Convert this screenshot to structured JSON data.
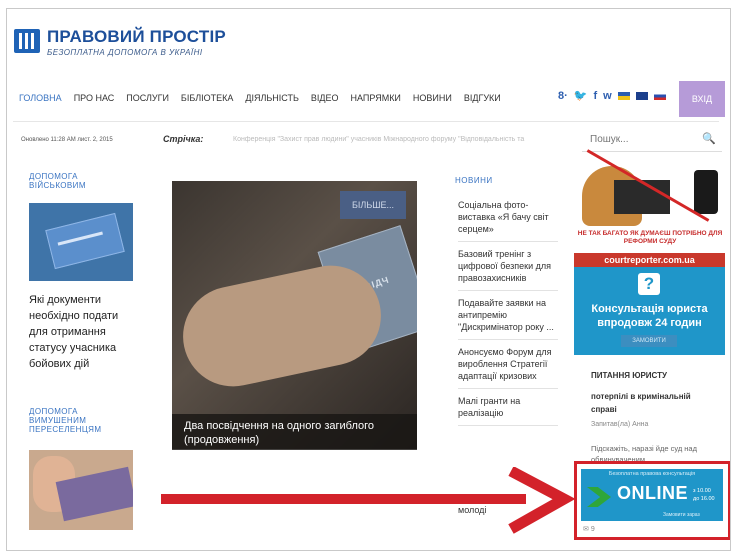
{
  "brand": {
    "name": "ПРАВОВИЙ ПРОСТІР",
    "tagline": "БЕЗОПЛАТНА ДОПОМОГА В УКРАЇНІ"
  },
  "nav": {
    "items": [
      "ГОЛОВНА",
      "ПРО НАС",
      "ПОСЛУГИ",
      "БІБЛІОТЕКА",
      "ДІЯЛЬНІСТЬ",
      "ВІДЕО",
      "НАПРЯМКИ",
      "НОВИНИ",
      "ВІДГУКИ"
    ],
    "active_index": 0
  },
  "social": {
    "icons": [
      "g+",
      "twitter-icon",
      "facebook-icon",
      "vk-icon"
    ],
    "labels": [
      "8·",
      "🐦",
      "f",
      "w"
    ]
  },
  "login": {
    "label": "ВХІД"
  },
  "ticker": {
    "updated": "Оновлено 11:28 AM лист. 2, 2015",
    "label": "Стрічка:",
    "text": "Конференція \"Захист прав людини\" учасників Міжнародного форуму \"Відповідальність та"
  },
  "search": {
    "placeholder": "Пошук..."
  },
  "left": {
    "section1": "ДОПОМОГА ВІЙСЬКОВИМ",
    "article1": "Які документи необхідно подати для отримання статусу учасника бойових дій",
    "section2": "ДОПОМОГА ВИМУШЕНИМ ПЕРЕСЕЛЕНЦЯМ"
  },
  "feature": {
    "more": "БІЛЬШЕ...",
    "card_text": "ПОСВІДЧ",
    "caption": "Два посвідчення на одного загиблого (продовження)"
  },
  "news": {
    "heading": "НОВИНИ",
    "items": [
      "Соціальна фото-виставка «Я бачу світ серцем»",
      "Базовий тренінг з цифрової безпеки для правозахисників",
      "Подавайте заявки на антипремію \"Дискримінатор року ...",
      "Анонсуємо Форум для вироблення Стратегії адаптації кризових",
      "Малі гранти на реалізацію"
    ],
    "last": "молоді"
  },
  "ads": {
    "reform": "НЕ ТАК БАГАТО ЯК ДУМАЄШ ПОТРІБНО ДЛЯ РЕФОРМИ СУДУ",
    "court": "courtreporter.com.ua",
    "consult_title": "Консультація юриста впродовж 24 годин",
    "consult_btn": "ЗАМОВИТИ"
  },
  "qa": {
    "heading": "ПИТАННЯ ЮРИСТУ",
    "question": "потерпілі в кримінальній справі",
    "author": "Запитав(ла) Анна",
    "text": "Підскажіть, наразі йде суд над обвинуваченим"
  },
  "online": {
    "top": "Безоплатна правова консультація",
    "word": "ONLINE",
    "time_from": "з 10.00",
    "time_to": "до 16.00",
    "order": "Замовити зараз",
    "comments": "9"
  },
  "arrow": {
    "color": "#d3222a"
  }
}
